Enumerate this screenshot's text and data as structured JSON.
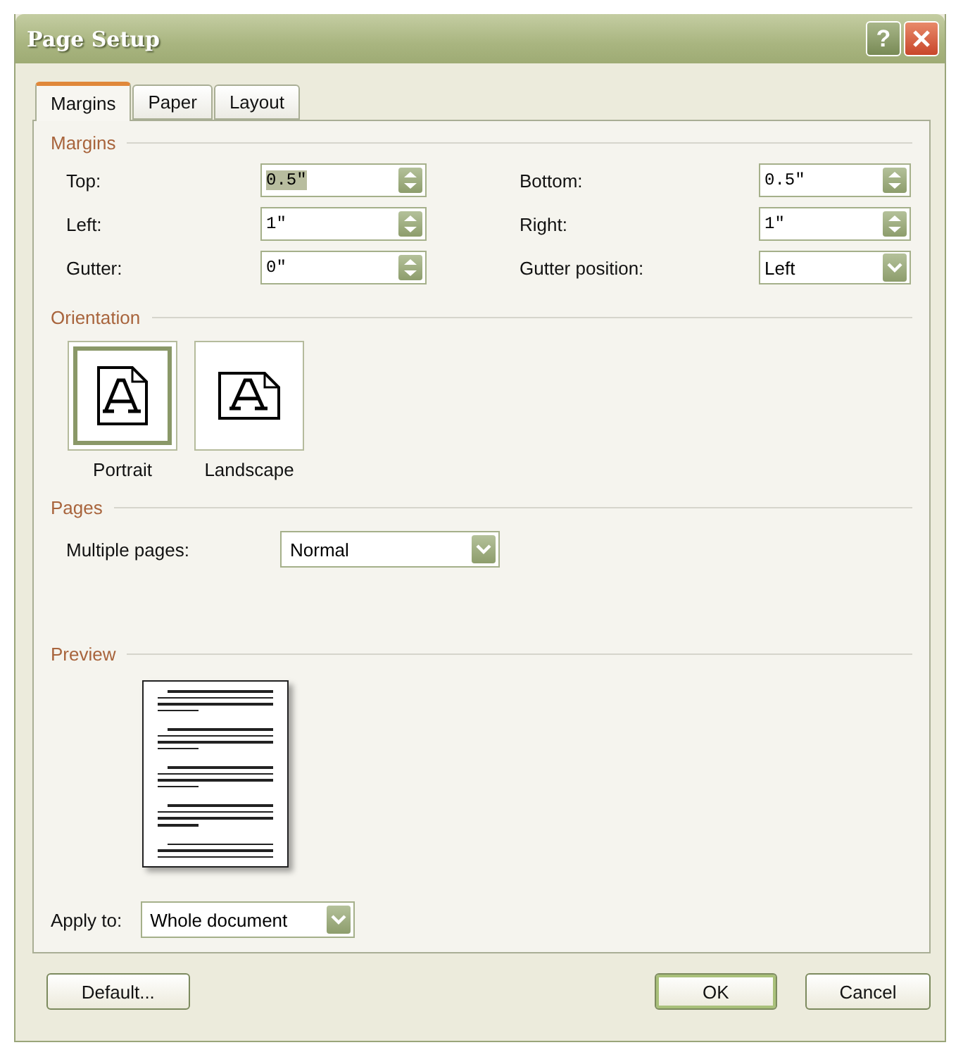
{
  "window": {
    "title": "Page Setup",
    "help_button": "?"
  },
  "tabs": [
    {
      "label": "Margins",
      "selected": true
    },
    {
      "label": "Paper",
      "selected": false
    },
    {
      "label": "Layout",
      "selected": false
    }
  ],
  "margins": {
    "title": "Margins",
    "fields": [
      {
        "label": "Top:",
        "value": "0.5\"",
        "kind": "spinner",
        "highlighted": true
      },
      {
        "label": "Bottom:",
        "value": "0.5\"",
        "kind": "spinner",
        "highlighted": false
      },
      {
        "label": "Left:",
        "value": "1\"",
        "kind": "spinner",
        "highlighted": false
      },
      {
        "label": "Right:",
        "value": "1\"",
        "kind": "spinner",
        "highlighted": false
      },
      {
        "label": "Gutter:",
        "value": "0\"",
        "kind": "spinner",
        "highlighted": false
      },
      {
        "label": "Gutter position:",
        "value": "Left",
        "kind": "dropdown",
        "highlighted": false
      }
    ]
  },
  "orientation": {
    "title": "Orientation",
    "options": [
      {
        "label": "Portrait",
        "kind": "portrait",
        "selected": true
      },
      {
        "label": "Landscape",
        "kind": "landscape",
        "selected": false
      }
    ]
  },
  "pages": {
    "title": "Pages",
    "label": "Multiple pages:",
    "value": "Normal"
  },
  "preview": {
    "title": "Preview"
  },
  "apply_to": {
    "label": "Apply to:",
    "value": "Whole document"
  },
  "buttons": [
    {
      "label": "Default...",
      "default": false
    },
    {
      "label": "OK",
      "default": true
    },
    {
      "label": "Cancel",
      "default": false
    }
  ]
}
